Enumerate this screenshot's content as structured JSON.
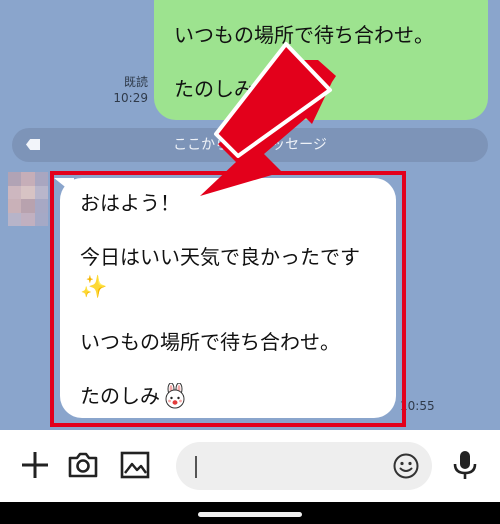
{
  "chat": {
    "outgoing": {
      "line1": "いつもの場所で待ち合わせ。",
      "line2": "たのしみ",
      "read_label": "既読",
      "time": "10:29"
    },
    "unread_separator": {
      "text": "ここから未読メッセージ"
    },
    "incoming": {
      "line1": "おはよう！",
      "line2": "今日はいい天気で良かったです",
      "line2_emoji": "✨",
      "line3": "いつもの場所で待ち合わせ。",
      "line4": "たのしみ",
      "sticker_icon": "bunny-face-icon",
      "time": "10:55"
    }
  },
  "annotation": {
    "highlight_color": "#e3001b"
  },
  "input_bar": {
    "icons": [
      "plus-icon",
      "camera-icon",
      "image-icon",
      "emoji-icon",
      "microphone-icon"
    ],
    "message_value": "",
    "message_placeholder": ""
  },
  "colors": {
    "chat_background": "#8aa5cc",
    "outgoing_bubble": "#9de38f",
    "incoming_bubble": "#ffffff"
  }
}
